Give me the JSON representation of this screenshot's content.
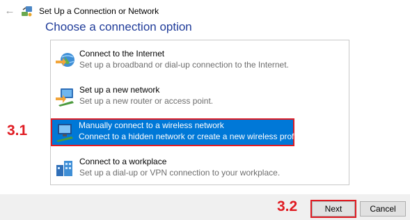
{
  "window": {
    "title": "Set Up a Connection or Network"
  },
  "heading": "Choose a connection option",
  "options": [
    {
      "title": "Connect to the Internet",
      "description": "Set up a broadband or dial-up connection to the Internet."
    },
    {
      "title": "Set up a new network",
      "description": "Set up a new router or access point."
    },
    {
      "title": "Manually connect to a wireless network",
      "description": "Connect to a hidden network or create a new wireless profile"
    },
    {
      "title": "Connect to a workplace",
      "description": "Set up a dial-up or VPN connection to your workplace."
    }
  ],
  "annotations": {
    "step1": "3.1",
    "step2": "3.2"
  },
  "buttons": {
    "next": "Next",
    "cancel": "Cancel"
  },
  "colors": {
    "selection": "#0078d7",
    "annotation": "#e01b22",
    "heading": "#1f3b99"
  },
  "icons": [
    "back-arrow-icon",
    "network-setup-icon",
    "internet-globe-icon",
    "router-icon",
    "wireless-monitor-icon",
    "workplace-icon"
  ]
}
